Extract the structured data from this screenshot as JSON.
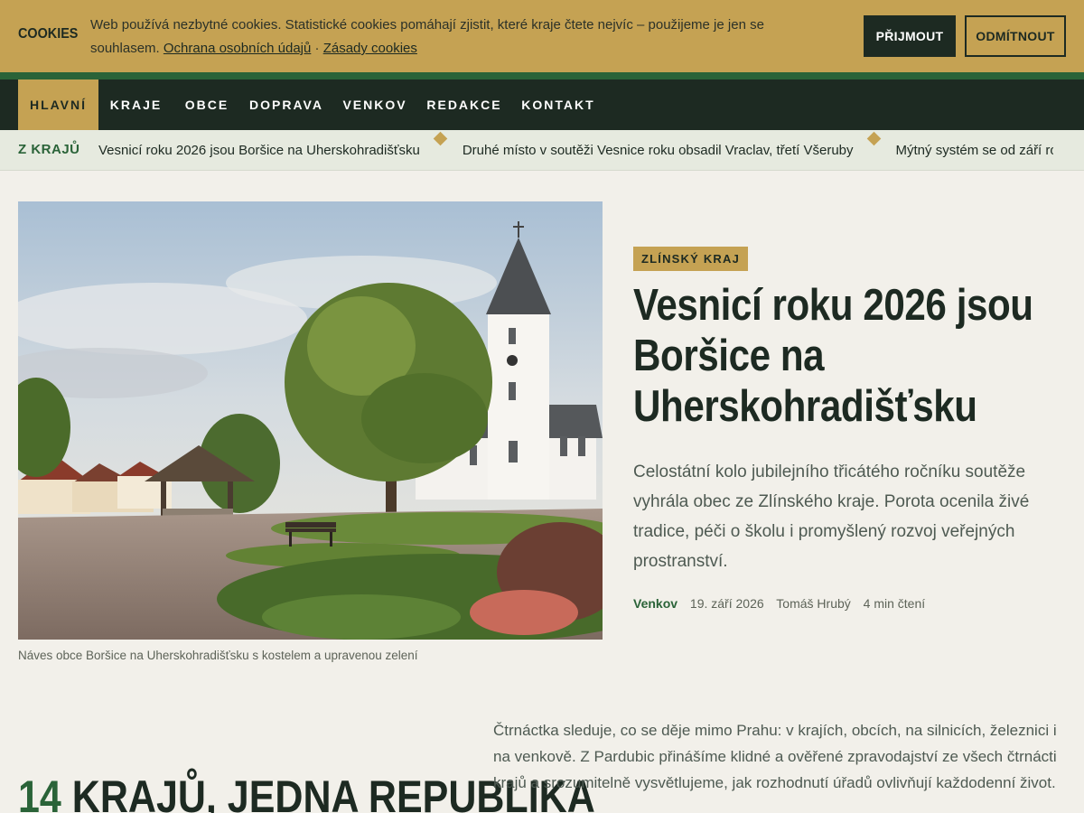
{
  "cookie": {
    "title": "COOKIES",
    "text": "Web používá nezbytné cookies. Statistické cookies pomáhají zjistit, které kraje čtete nejvíc – použijeme je jen se souhlasem.",
    "link_privacy": "Ochrana osobních údajů",
    "separator": "·",
    "link_cookies": "Zásady cookies",
    "accept_label": "Přijmout",
    "reject_label": "Odmítnout"
  },
  "nav": {
    "items": [
      {
        "label": "Hlavní",
        "active": true
      },
      {
        "label": "Kraje"
      },
      {
        "label": "Obce"
      },
      {
        "label": "Doprava"
      },
      {
        "label": "Venkov"
      },
      {
        "label": "Redakce"
      },
      {
        "label": "Kontakt"
      }
    ]
  },
  "ticker": {
    "label": "Z KRAJŮ",
    "items": [
      "Vesnicí roku 2026 jsou Boršice na Uherskohradišťsku",
      "Druhé místo v soutěži Vesnice roku obsadil Vraclav, třetí Všeruby",
      "Mýtný systém se od září rozšíří"
    ]
  },
  "hero": {
    "image_alt": "Náves obce Boršice na Uherskohradišťsku s kostelem a upravenou zelení",
    "caption": "Náves obce Boršice na Uherskohradišťsku s kostelem a upravenou zelení",
    "tag": "ZLÍNSKÝ KRAJ",
    "headline": "Vesnicí roku 2026 jsou Boršice na Uherskohradišťsku",
    "lede": "Celostátní kolo jubilejního třicátého ročníku soutěže vyhrála obec ze Zlínského kraje. Porota ocenila živé tradice, péči o školu i promyšlený rozvoj veřejných prostranství.",
    "meta": {
      "section": "Venkov",
      "date": "19. září 2026",
      "author": "Tomáš Hrubý",
      "read_time": "4 min čtení"
    }
  },
  "section": {
    "heading_number": "14",
    "heading_text": " KRAJŮ, JEDNA REPUBLIKA",
    "intro": "Čtrnáctka sleduje, co se děje mimo Prahu: v krajích, obcích, na silnicích, železnici i na venkově. Z Pardubic přinášíme klidné a ověřené zpravodajství ze všech čtrnácti krajů a srozumitelně vysvětlujeme, jak rozhodnutí úřadů ovlivňují každodenní život."
  },
  "colors": {
    "accent_gold": "#c5a253",
    "dark_green": "#1d2a22",
    "brand_green": "#2a6338",
    "page_bg": "#f2f0ea"
  }
}
